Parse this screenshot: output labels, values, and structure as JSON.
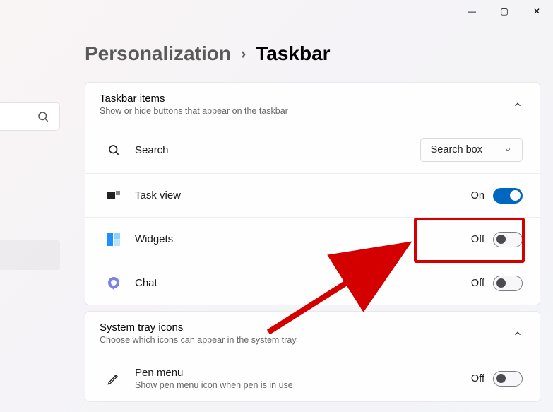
{
  "window_controls": {
    "min": "—",
    "max": "▢",
    "close": "✕"
  },
  "breadcrumb": {
    "parent": "Personalization",
    "sep": "›",
    "current": "Taskbar"
  },
  "sections": {
    "taskbar_items": {
      "title": "Taskbar items",
      "subtitle": "Show or hide buttons that appear on the taskbar",
      "rows": {
        "search": {
          "label": "Search",
          "dropdown_value": "Search box"
        },
        "task_view": {
          "label": "Task view",
          "state_label": "On",
          "on": true
        },
        "widgets": {
          "label": "Widgets",
          "state_label": "Off",
          "on": false
        },
        "chat": {
          "label": "Chat",
          "state_label": "Off",
          "on": false
        }
      }
    },
    "system_tray": {
      "title": "System tray icons",
      "subtitle": "Choose which icons can appear in the system tray",
      "rows": {
        "pen_menu": {
          "label": "Pen menu",
          "sub": "Show pen menu icon when pen is in use",
          "state_label": "Off",
          "on": false
        }
      }
    }
  },
  "annotation": {
    "highlight_target": "widgets-toggle"
  }
}
